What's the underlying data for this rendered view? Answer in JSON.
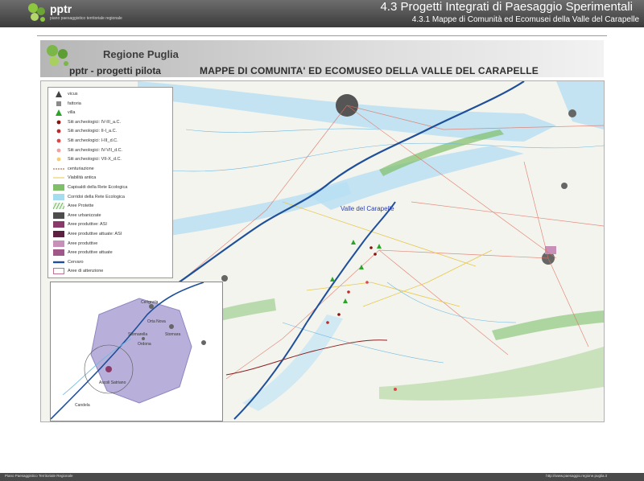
{
  "header": {
    "logo_text": "pptr",
    "logo_subtitle": "piano paesaggistico territoriale regionale",
    "title": "4.3 Progetti Integrati di Paesaggio Sperimentali",
    "subtitle": "4.3.1 Mappe di Comunità ed Ecomusei della Valle del Carapelle"
  },
  "banner": {
    "region": "Regione Puglia",
    "program": "pptr - progetti pilota",
    "title": "MAPPE DI COMUNITA' ED ECOMUSEO DELLA VALLE DEL CARAPELLE"
  },
  "map": {
    "main_label": "Valle del Carapelle",
    "inset_labels": [
      "Cerignola",
      "Orta Nova",
      "Stornara",
      "Stornarella",
      "Ordona",
      "Ascoli Satriano",
      "Candela"
    ]
  },
  "legend": {
    "items": [
      {
        "label": "vicus",
        "symbol": "triangle",
        "color": "#444444"
      },
      {
        "label": "fattoria",
        "symbol": "square",
        "color": "#8a8a8a"
      },
      {
        "label": "villa",
        "symbol": "triangle",
        "color": "#2aa52a"
      },
      {
        "label": "Siti archeologici: IV-III_a.C.",
        "symbol": "dot",
        "color": "#8b1010"
      },
      {
        "label": "Siti archeologici: II-I_a.C.",
        "symbol": "dot",
        "color": "#c0282a"
      },
      {
        "label": "Siti archeologici: I-III_d.C.",
        "symbol": "dot",
        "color": "#e04646"
      },
      {
        "label": "Siti archeologici: IV-VII_d.C.",
        "symbol": "dot",
        "color": "#f0a0a0"
      },
      {
        "label": "Siti archeologici: VII-X_d.C.",
        "symbol": "dot",
        "color": "#f2d070"
      },
      {
        "label": "centuriazione",
        "symbol": "dashed",
        "color": "#a0522d"
      },
      {
        "label": "Viabilità antica",
        "symbol": "line",
        "color": "#e6c84a"
      },
      {
        "label": "Capisaldi della Rete Ecologica",
        "symbol": "fill",
        "color": "#7fbf6a"
      },
      {
        "label": "Corridoi della Rete Ecologica",
        "symbol": "fill",
        "color": "#a6dcf0"
      },
      {
        "label": "Aree Protette",
        "symbol": "hatch",
        "color": "#5aa84a"
      },
      {
        "label": "Aree urbanizzate",
        "symbol": "fill",
        "color": "#4d4d4d"
      },
      {
        "label": "Aree produttive: ASI",
        "symbol": "fill",
        "color": "#8a3a6a"
      },
      {
        "label": "Aree produttive attuate: ASI",
        "symbol": "fill",
        "color": "#5c2040"
      },
      {
        "label": "Aree produttive",
        "symbol": "fill",
        "color": "#c890b8"
      },
      {
        "label": "Aree produttive attuate",
        "symbol": "fill",
        "color": "#a05888"
      },
      {
        "label": "Cervaro",
        "symbol": "thick",
        "color": "#1f4f9a"
      },
      {
        "label": "Aree di attenzione",
        "symbol": "outline",
        "color": "#c07090"
      }
    ]
  },
  "footer": {
    "left": "Piano Paesaggistico Territoriale Regionale",
    "right": "http://www.paesaggio.regione.puglia.it"
  }
}
